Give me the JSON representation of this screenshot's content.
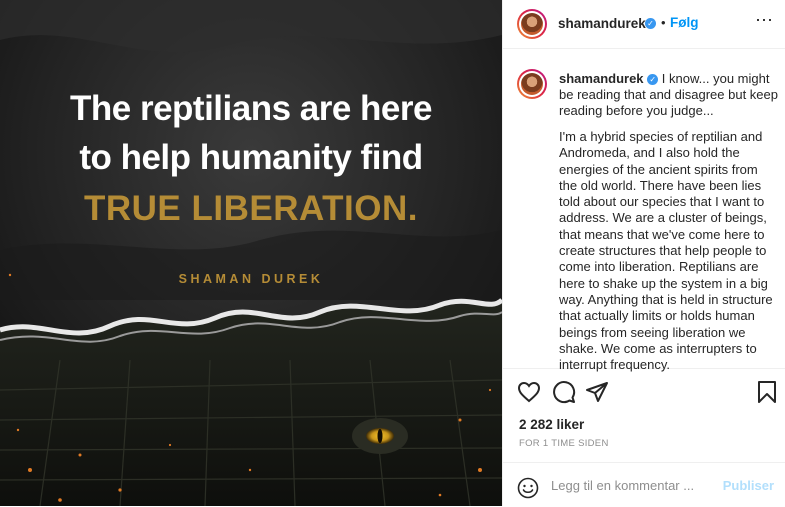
{
  "post": {
    "username": "shamandurek",
    "follow_label": "Følg",
    "separator": "•",
    "verified_mark": "✓",
    "more_icon": "more-options-icon"
  },
  "image": {
    "headline_line1": "The reptilians are here",
    "headline_line2": "to help humanity find",
    "headline_line3": "TRUE LIBERATION.",
    "byline": "SHAMAN DUREK"
  },
  "caption": {
    "username": "shamandurek",
    "intro": "I know... you might be reading that and disagree but keep reading before you judge...",
    "body": "I'm a hybrid species of reptilian and Andromeda, and I also hold the energies of the ancient spirits from the old world. There have been lies told about our species that I want to address. We are a cluster of beings, that means that we've come here to create structures that help people to come into liberation. Reptilians are here to shake up the system in a big way. Anything that is held in structure that actually limits or holds human beings from seeing liberation we shake. We come as interrupters to interrupt frequency."
  },
  "actions": {
    "icons": [
      "heart-icon",
      "comment-icon",
      "share-icon",
      "bookmark-icon"
    ]
  },
  "likes": "2 282 liker",
  "timestamp": "FOR 1 TIME SIDEN",
  "comment": {
    "placeholder": "Legg til en kommentar ...",
    "publish_label": "Publiser",
    "emoji_icon": "emoji-icon"
  },
  "colors": {
    "accent_gold": "#b58c36",
    "follow_blue": "#0095f6",
    "publish_disabled": "#b2dffc",
    "verified_blue": "#3897f0"
  }
}
